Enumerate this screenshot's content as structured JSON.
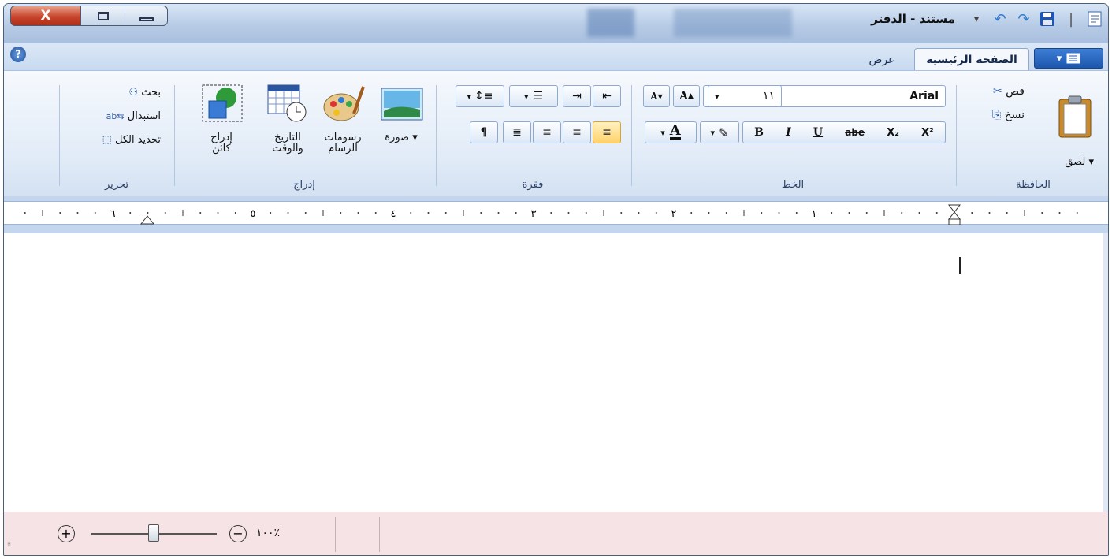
{
  "window": {
    "title": "مستند - الدفتر",
    "close_glyph": "X",
    "colors": {
      "frame": "#b7cbe6",
      "ribbon": "#e1ebf7",
      "status": "#f6e3e6",
      "accent": "#1d57ad"
    }
  },
  "tabs": [
    {
      "label": "الصفحة الرئيسية",
      "active": true
    },
    {
      "label": "عرض",
      "active": false
    }
  ],
  "app_menu_icon": "menu-icon",
  "ribbon": {
    "clipboard": {
      "label": "الحافظة",
      "paste": "لصق",
      "cut": "قص",
      "copy": "نسخ"
    },
    "font": {
      "label": "الخط",
      "font_name": "Arial",
      "font_size": "١١",
      "grow": "A",
      "shrink": "A",
      "bold": "B",
      "italic": "I",
      "underline": "U",
      "strike": "abe",
      "subscript": "X₂",
      "superscript": "X²",
      "text_color": "A"
    },
    "paragraph": {
      "label": "فقرة"
    },
    "insert": {
      "label": "إدراج",
      "picture": "صورة",
      "paint_line1": "رسومات",
      "paint_line2": "الرسام",
      "datetime_line1": "التاريخ",
      "datetime_line2": "والوقت",
      "object_line1": "إدراج",
      "object_line2": "كائن"
    },
    "editing": {
      "label": "تحرير",
      "find": "بحث",
      "replace": "استبدال",
      "select_all": "تحديد الكل"
    }
  },
  "ruler": {
    "numbers": [
      "١",
      "٢",
      "٣",
      "٤",
      "٥",
      "٦"
    ]
  },
  "status": {
    "zoom": "١٠٠٪",
    "zoom_level": 1.0
  }
}
